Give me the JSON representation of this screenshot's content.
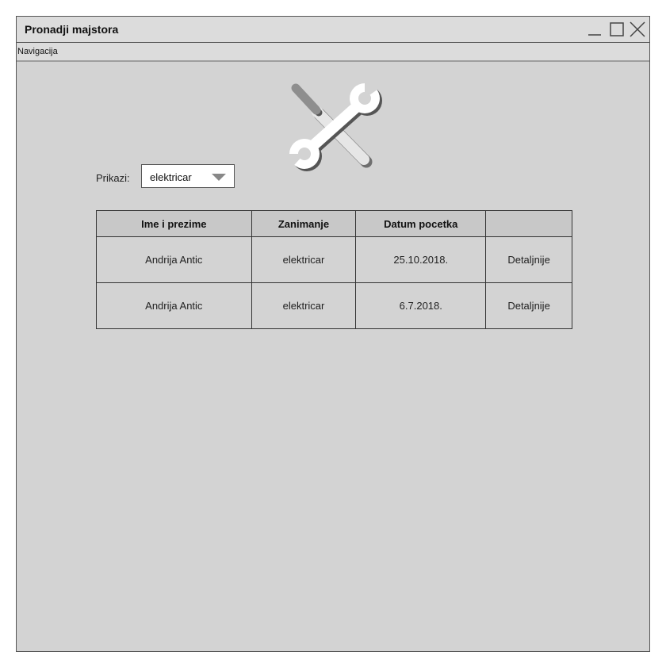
{
  "window": {
    "title": "Pronadji majstora"
  },
  "menu": {
    "items": [
      "Navigacija"
    ]
  },
  "icons": {
    "logo": "wrench-screwdriver-icon",
    "minimize": "minimize-icon",
    "maximize": "maximize-icon",
    "close": "close-icon"
  },
  "filter": {
    "label": "Prikazi:",
    "selected": "elektricar"
  },
  "table": {
    "headers": [
      "Ime i prezime",
      "Zanimanje",
      "Datum pocetka",
      ""
    ],
    "rows": [
      {
        "name": "Andrija Antic",
        "occupation": "elektricar",
        "start_date": "25.10.2018.",
        "action": "Detaljnije"
      },
      {
        "name": "Andrija Antic",
        "occupation": "elektricar",
        "start_date": "6.7.2018.",
        "action": "Detaljnije"
      }
    ]
  },
  "colors": {
    "background": "#d3d3d3",
    "titlebar": "#dcdcdc",
    "border": "#555555",
    "header_row": "#c8c8c8"
  }
}
